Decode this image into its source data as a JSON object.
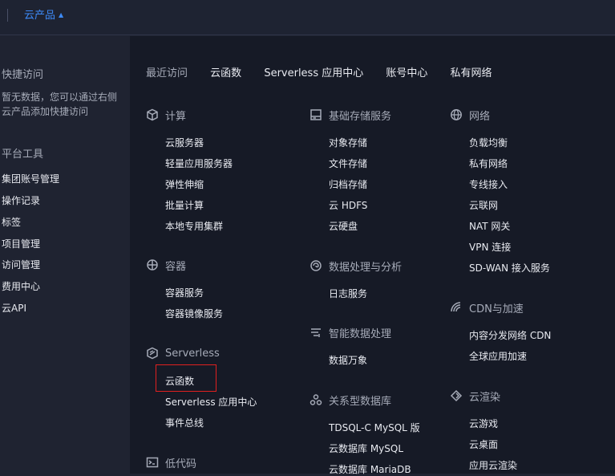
{
  "topbar": {
    "product_label": "云产品"
  },
  "sidebar": {
    "quick_access_title": "快捷访问",
    "quick_access_empty": "暂无数据，您可以通过右侧云产品添加快捷访问",
    "platform_tools_title": "平台工具",
    "items": [
      "集团账号管理",
      "操作记录",
      "标签",
      "项目管理",
      "访问管理",
      "费用中心",
      "云API"
    ]
  },
  "recent": {
    "label": "最近访问",
    "items": [
      "云函数",
      "Serverless 应用中心",
      "账号中心",
      "私有网络"
    ]
  },
  "categories": {
    "compute": {
      "title": "计算",
      "icon": "cube-icon",
      "items": [
        "云服务器",
        "轻量应用服务器",
        "弹性伸缩",
        "批量计算",
        "本地专用集群"
      ]
    },
    "container": {
      "title": "容器",
      "icon": "container-icon",
      "items": [
        "容器服务",
        "容器镜像服务"
      ]
    },
    "serverless": {
      "title": "Serverless",
      "icon": "serverless-icon",
      "items": [
        "云函数",
        "Serverless 应用中心",
        "事件总线"
      ]
    },
    "lowcode": {
      "title": "低代码",
      "icon": "terminal-icon",
      "items": []
    },
    "storage": {
      "title": "基础存储服务",
      "icon": "storage-icon",
      "items": [
        "对象存储",
        "文件存储",
        "归档存储",
        "云 HDFS",
        "云硬盘"
      ]
    },
    "dataproc": {
      "title": "数据处理与分析",
      "icon": "swirl-icon",
      "items": [
        "日志服务"
      ]
    },
    "smartdata": {
      "title": "智能数据处理",
      "icon": "list-filter-icon",
      "items": [
        "数据万象"
      ]
    },
    "rdb": {
      "title": "关系型数据库",
      "icon": "database-nodes-icon",
      "items": [
        "TDSQL-C MySQL 版",
        "云数据库 MySQL",
        "云数据库 MariaDB"
      ]
    },
    "network": {
      "title": "网络",
      "icon": "globe-icon",
      "items": [
        "负载均衡",
        "私有网络",
        "专线接入",
        "云联网",
        "NAT 网关",
        "VPN 连接",
        "SD-WAN 接入服务"
      ]
    },
    "cdn": {
      "title": "CDN与加速",
      "icon": "signal-icon",
      "items": [
        "内容分发网络 CDN",
        "全球应用加速"
      ]
    },
    "render": {
      "title": "云渲染",
      "icon": "spiral-icon",
      "items": [
        "云游戏",
        "云桌面",
        "应用云渲染"
      ]
    }
  },
  "colors": {
    "accent": "#3d8af7",
    "highlight": "#e0201f",
    "panel": "#161a26",
    "sidebar": "#1f2331"
  }
}
